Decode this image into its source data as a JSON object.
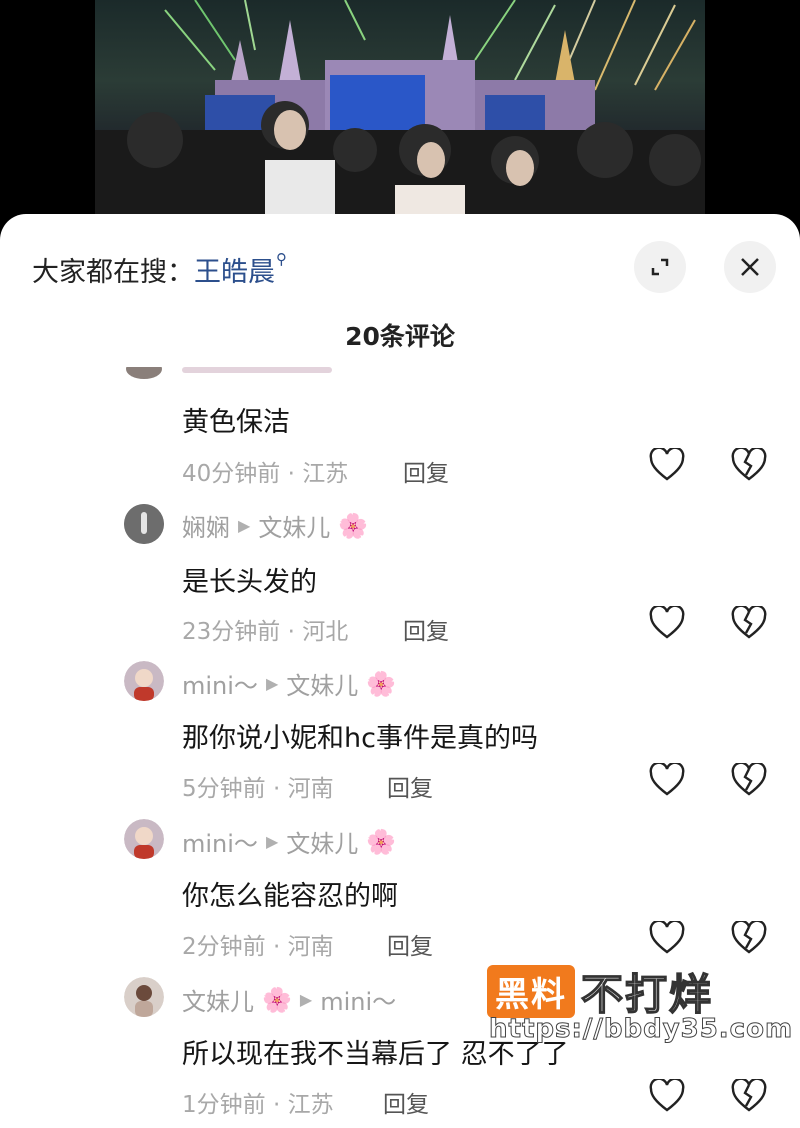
{
  "search_bar": {
    "prefix": "大家都在搜：",
    "keyword": "王皓晨"
  },
  "comment_count_title": "20条评论",
  "comments": [
    {
      "text": "黄色保洁",
      "time": "40分钟前",
      "location": "江苏",
      "reply": "回复"
    },
    {
      "user": "娴娴",
      "reply_to": "文妹儿",
      "text": "是长头发的",
      "time": "23分钟前",
      "location": "河北",
      "reply": "回复"
    },
    {
      "user": "mini～",
      "reply_to": "文妹儿",
      "text": "那你说小妮和hc事件是真的吗",
      "time": "5分钟前",
      "location": "河南",
      "reply": "回复"
    },
    {
      "user": "mini～",
      "reply_to": "文妹儿",
      "text": "你怎么能容忍的啊",
      "time": "2分钟前",
      "location": "河南",
      "reply": "回复"
    },
    {
      "user": "文妹儿",
      "reply_to": "mini～",
      "text": "所以现在我不当幕后了 忍不了了",
      "time": "1分钟前",
      "location": "江苏",
      "reply": "回复"
    }
  ],
  "watermark": {
    "box_text": "黑料",
    "rest_text": "不打烊",
    "url": "https://bbdy35.com"
  },
  "colors": {
    "accent_link": "#2c4f8c",
    "watermark_orange": "#f17a1d"
  }
}
